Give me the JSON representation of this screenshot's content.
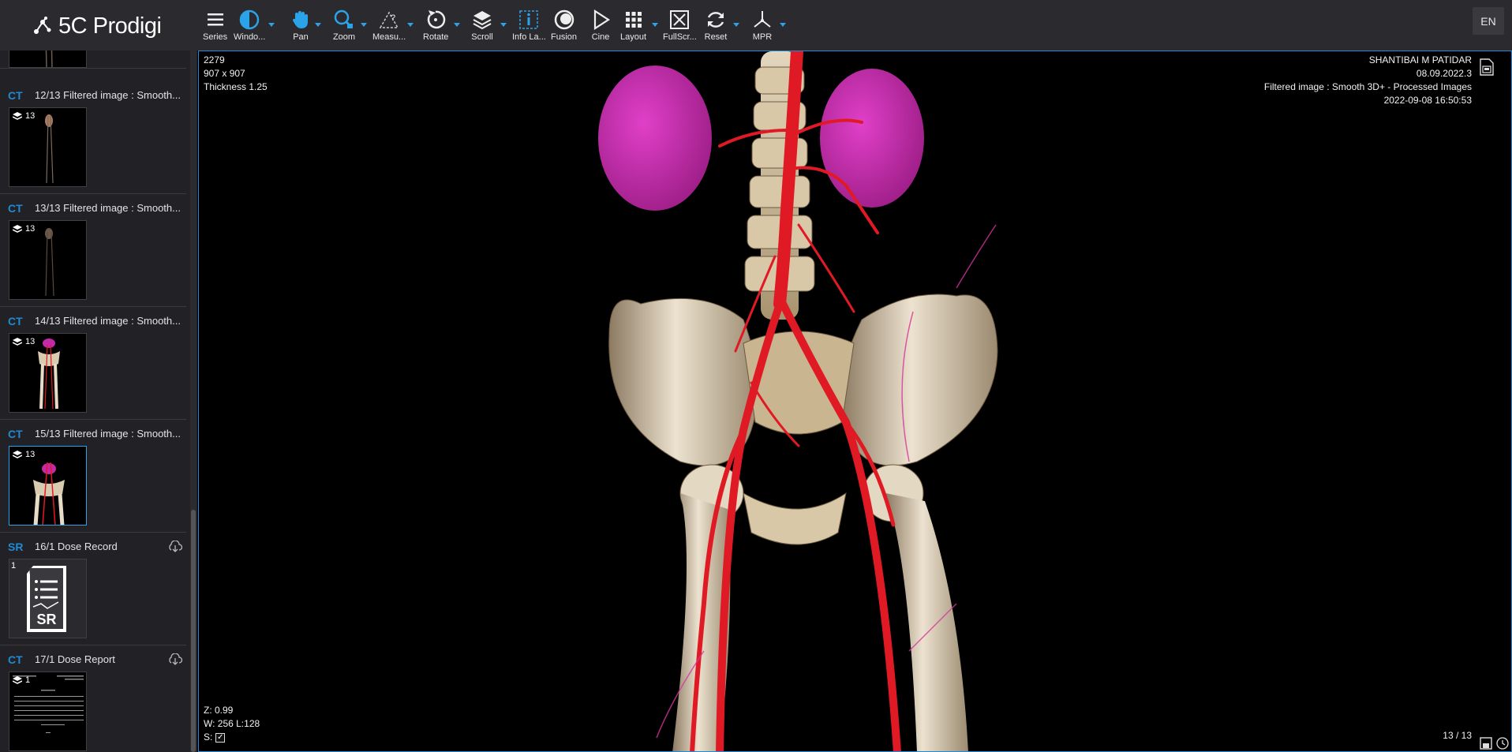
{
  "app": {
    "name": "5C Prodigi",
    "language": "EN"
  },
  "toolbar": [
    {
      "label": "Series"
    },
    {
      "label": "Windo..."
    },
    {
      "label": "Pan"
    },
    {
      "label": "Zoom"
    },
    {
      "label": "Measu..."
    },
    {
      "label": "Rotate"
    },
    {
      "label": "Scroll"
    },
    {
      "label": "Info La..."
    },
    {
      "label": "Fusion"
    },
    {
      "label": "Cine"
    },
    {
      "label": "Layout"
    },
    {
      "label": "FullScr..."
    },
    {
      "label": "Reset"
    },
    {
      "label": "MPR"
    }
  ],
  "series": [
    {
      "modality": "CT",
      "description": "12/13 Filtered image : Smooth...",
      "count": "13"
    },
    {
      "modality": "CT",
      "description": "13/13 Filtered image : Smooth...",
      "count": "13"
    },
    {
      "modality": "CT",
      "description": "14/13 Filtered image : Smooth...",
      "count": "13"
    },
    {
      "modality": "CT",
      "description": "15/13 Filtered image : Smooth...",
      "count": "13"
    },
    {
      "modality": "SR",
      "description": "16/1 Dose Record",
      "count": "1",
      "thumb_label": "SR"
    },
    {
      "modality": "CT",
      "description": "17/1 Dose Report",
      "count": "1"
    }
  ],
  "viewport": {
    "top_left": [
      "2279",
      "907 x 907",
      "Thickness 1.25"
    ],
    "top_right": [
      "SHANTIBAI M PATIDAR",
      "08.09.2022.3",
      "Filtered image : Smooth 3D+ - Processed Images",
      "2022-09-08 16:50:53"
    ],
    "zoom": "Z: 0.99",
    "window": "W: 256 L:128",
    "sync_label": "S:",
    "image_index": "13 / 13"
  },
  "colors": {
    "accent": "#1f8ad6",
    "toolbar_bg": "#2b2b2f",
    "sidebar_bg": "#222226",
    "vessel": "#e01a24",
    "kidney": "#c42aa8",
    "bone": "#d9cbb0"
  }
}
